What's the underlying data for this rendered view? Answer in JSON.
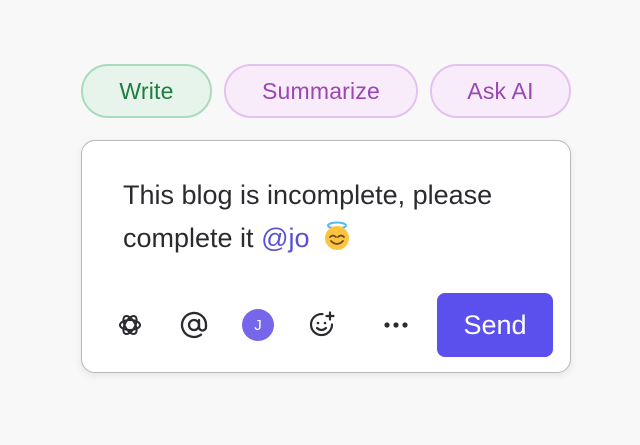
{
  "chips": {
    "write": "Write",
    "summarize": "Summarize",
    "ask_ai": "Ask AI"
  },
  "composer": {
    "message_text": "This blog is incomplete, please complete it",
    "mention": "@jo",
    "emoji": "😇"
  },
  "toolbar": {
    "avatar_initial": "J",
    "send_label": "Send",
    "icons": [
      "openai-icon",
      "at-sign-icon",
      "user-avatar",
      "add-emoji-icon",
      "more-icon"
    ]
  },
  "colors": {
    "write_chip_text": "#1d7d3f",
    "ai_chip_text": "#9a46b3",
    "accent": "#5b50ee",
    "mention": "#5a4fd6"
  }
}
